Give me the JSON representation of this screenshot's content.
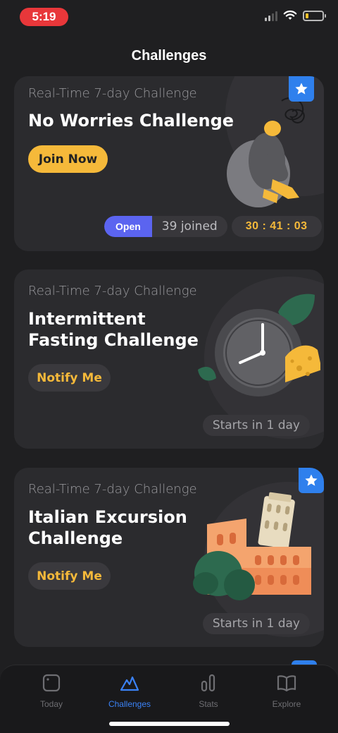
{
  "status": {
    "time": "5:19"
  },
  "header": {
    "title": "Challenges"
  },
  "cards": [
    {
      "subtitle": "Real-Time 7-day Challenge",
      "title": "No Worries Challenge",
      "button": "Join Now",
      "status_label": "Open",
      "joined_count": "39",
      "joined_label": "joined",
      "timer": "30 : 41 : 03",
      "starred": true
    },
    {
      "subtitle": "Real-Time 7-day Challenge",
      "title": "Intermittent\nFasting Challenge",
      "button": "Notify Me",
      "starts": "Starts in 1 day",
      "starred": false
    },
    {
      "subtitle": "Real-Time 7-day Challenge",
      "title": "Italian Excursion\nChallenge",
      "button": "Notify Me",
      "starts": "Starts in 1 day",
      "starred": true
    }
  ],
  "tabbar": {
    "items": [
      {
        "label": "Today",
        "icon": "today-icon"
      },
      {
        "label": "Challenges",
        "icon": "challenges-icon",
        "active": true
      },
      {
        "label": "Stats",
        "icon": "stats-icon"
      },
      {
        "label": "Explore",
        "icon": "explore-icon"
      }
    ]
  },
  "colors": {
    "accent": "#f5b93a",
    "active_tab": "#3b82f6",
    "open_pill": "#5b64f0",
    "star_badge": "#2f80ed"
  }
}
